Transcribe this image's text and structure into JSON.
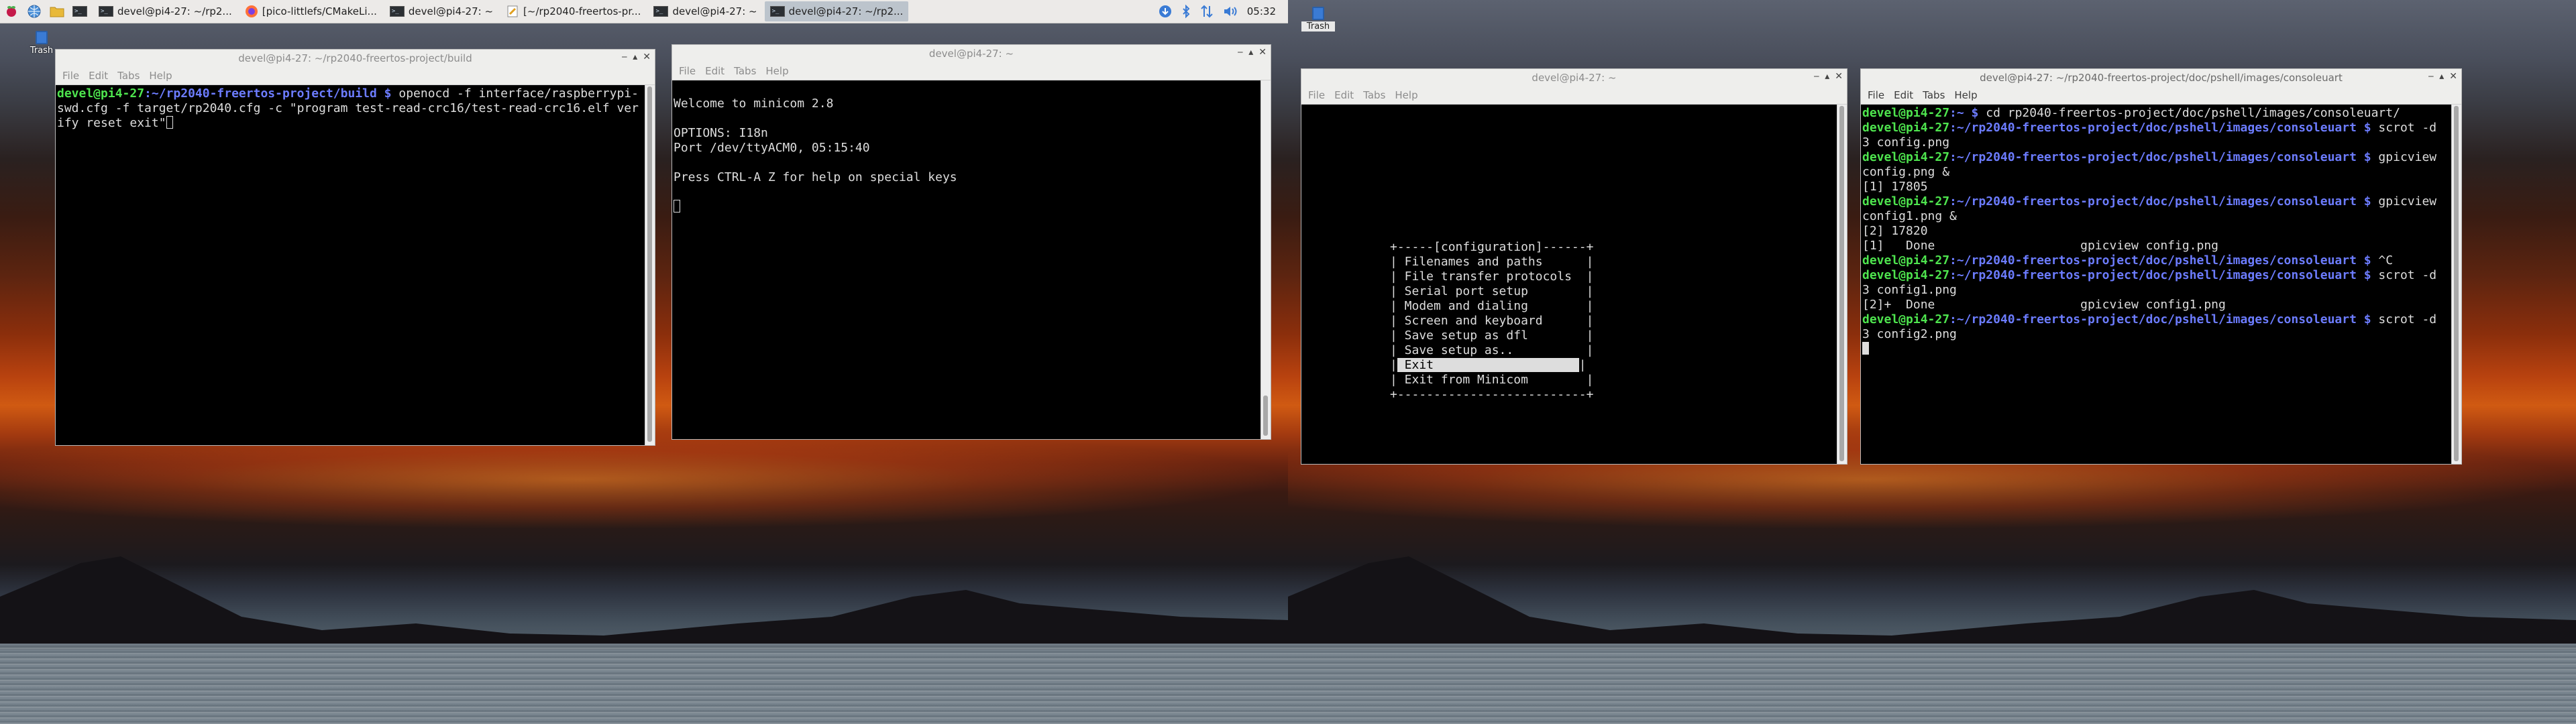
{
  "taskbar": {
    "tasks": [
      {
        "label": "devel@pi4-27: ~/rp2..."
      },
      {
        "label": "[pico-littlefs/CMakeLi..."
      },
      {
        "label": "devel@pi4-27: ~"
      },
      {
        "label": "[~/rp2040-freertos-pr..."
      },
      {
        "label": "devel@pi4-27: ~"
      },
      {
        "label": "devel@pi4-27: ~/rp2..."
      }
    ],
    "clock": "05:32"
  },
  "desktop": {
    "trash_label": "Trash"
  },
  "menu": {
    "file": "File",
    "edit": "Edit",
    "tabs": "Tabs",
    "help": "Help"
  },
  "windows": {
    "openocd": {
      "title": "devel@pi4-27: ~/rp2040-freertos-project/build",
      "prompt_user": "devel@pi4-27",
      "prompt_path": ":~/rp2040-freertos-project/build $",
      "command_line1": " openocd -f interface/raspberrypi-",
      "command_line2": "swd.cfg -f target/rp2040.cfg -c \"program test-read-crc16/test-read-crc16.elf ver",
      "command_line3": "ify reset exit\""
    },
    "minicom": {
      "title": "devel@pi4-27: ~",
      "lines": [
        "",
        "Welcome to minicom 2.8",
        "",
        "OPTIONS: I18n",
        "Port /dev/ttyACM0, 05:15:40",
        "",
        "Press CTRL-A Z for help on special keys"
      ]
    },
    "config": {
      "title": "devel@pi4-27: ~",
      "menu_top": "+-----[configuration]------+",
      "menu_items": [
        "| Filenames and paths      |",
        "| File transfer protocols  |",
        "| Serial port setup        |",
        "| Modem and dialing        |",
        "| Screen and keyboard      |",
        "| Save setup as dfl        |",
        "| Save setup as..          |"
      ],
      "menu_selected": " Exit                    ",
      "menu_last": "| Exit from Minicom        |",
      "menu_bottom": "+--------------------------+"
    },
    "shell": {
      "title": "devel@pi4-27: ~/rp2040-freertos-project/doc/pshell/images/consoleuart",
      "lines": [
        {
          "user": "devel@pi4-27",
          "path": ":~ $",
          "cmd": " cd rp2040-freertos-project/doc/pshell/images/consoleuart/"
        },
        {
          "text": "devel@pi4-27:~/rp2040-freertos-project/doc/pshell/images/consoleuart $ scrot -d",
          "user": "devel@pi4-27",
          "path": ":~/rp2040-freertos-project/doc/pshell/images/consoleuart $",
          "cmd": " scrot -d"
        },
        {
          "text": "3 config.png"
        },
        {
          "user": "devel@pi4-27",
          "path": ":~/rp2040-freertos-project/doc/pshell/images/consoleuart $",
          "cmd": " gpicview"
        },
        {
          "text": "config.png &"
        },
        {
          "text": "[1] 17805"
        },
        {
          "user": "devel@pi4-27",
          "path": ":~/rp2040-freertos-project/doc/pshell/images/consoleuart $",
          "cmd": " gpicview"
        },
        {
          "text": "config1.png &"
        },
        {
          "text": "[2] 17820"
        },
        {
          "text": "[1]   Done                    gpicview config.png"
        },
        {
          "user": "devel@pi4-27",
          "path": ":~/rp2040-freertos-project/doc/pshell/images/consoleuart $",
          "cmd": " ^C"
        },
        {
          "user": "devel@pi4-27",
          "path": ":~/rp2040-freertos-project/doc/pshell/images/consoleuart $",
          "cmd": " scrot -d"
        },
        {
          "text": "3 config1.png"
        },
        {
          "text": "[2]+  Done                    gpicview config1.png"
        },
        {
          "user": "devel@pi4-27",
          "path": ":~/rp2040-freertos-project/doc/pshell/images/consoleuart $",
          "cmd": " scrot -d"
        },
        {
          "text": "3 config2.png"
        }
      ]
    }
  }
}
